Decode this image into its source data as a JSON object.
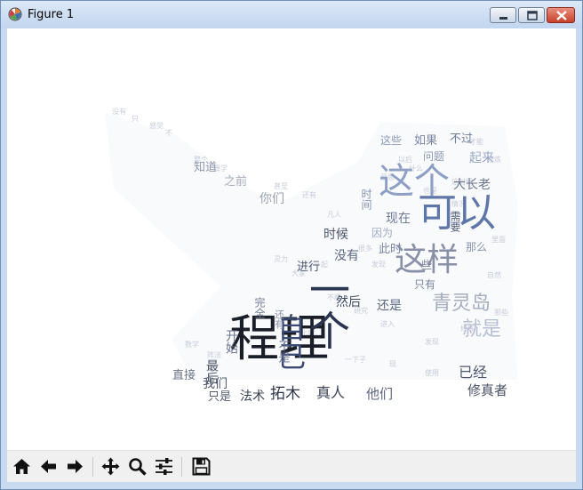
{
  "window": {
    "title": "Figure 1",
    "app_icon": "matplotlib-icon",
    "controls": [
      "minimize-icon",
      "maximize-icon",
      "close-icon"
    ]
  },
  "toolbar": {
    "buttons": [
      {
        "name": "home",
        "icon": "home-icon"
      },
      {
        "name": "back",
        "icon": "arrow-left-icon"
      },
      {
        "name": "forward",
        "icon": "arrow-right-icon"
      },
      {
        "name": "pan",
        "icon": "move-icon"
      },
      {
        "name": "zoom",
        "icon": "magnifier-icon"
      },
      {
        "name": "configure-subplots",
        "icon": "sliders-icon"
      },
      {
        "name": "save",
        "icon": "floppy-disk-icon"
      }
    ]
  },
  "word_cloud": {
    "words": [
      {
        "text": "程理",
        "color": "#1a1e28"
      },
      {
        "text": "自己",
        "color": "#3b4a72"
      },
      {
        "text": "一个",
        "color": "#2a3350"
      },
      {
        "text": "这个",
        "color": "#8e9fc6"
      },
      {
        "text": "可以",
        "color": "#5e76a8"
      },
      {
        "text": "这样",
        "color": "#8a8fa8"
      },
      {
        "text": "青灵岛",
        "color": "#a6acc0"
      },
      {
        "text": "就是",
        "color": "#b7bdd3"
      },
      {
        "text": "已经",
        "color": "#4e5670"
      },
      {
        "text": "修真者",
        "color": "#4a5066"
      },
      {
        "text": "真人",
        "color": "#3e4558"
      },
      {
        "text": "拓木",
        "color": "#2f3549"
      },
      {
        "text": "法术",
        "color": "#3a4155"
      },
      {
        "text": "只是",
        "color": "#555c70"
      },
      {
        "text": "他们",
        "color": "#5a6480"
      },
      {
        "text": "我们",
        "color": "#525a70"
      },
      {
        "text": "直接",
        "color": "#6b7388"
      },
      {
        "text": "最后",
        "color": "#4b526a"
      },
      {
        "text": "开始",
        "color": "#6a7290"
      },
      {
        "text": "然后",
        "color": "#3f4760"
      },
      {
        "text": "还是",
        "color": "#5d6784"
      },
      {
        "text": "进行",
        "color": "#4f5874"
      },
      {
        "text": "时候",
        "color": "#4d556e"
      },
      {
        "text": "没有",
        "color": "#5b6684"
      },
      {
        "text": "现在",
        "color": "#6c7896"
      },
      {
        "text": "因为",
        "color": "#a2abc4"
      },
      {
        "text": "此时",
        "color": "#7c88a8"
      },
      {
        "text": "那么",
        "color": "#8b94ad"
      },
      {
        "text": "只有",
        "color": "#7a839d"
      },
      {
        "text": "你们",
        "color": "#9aa0b4"
      },
      {
        "text": "知道",
        "color": "#9096ac"
      },
      {
        "text": "之前",
        "color": "#a7abbd"
      },
      {
        "text": "如果",
        "color": "#7a86a8"
      },
      {
        "text": "不过",
        "color": "#6f7b9a"
      },
      {
        "text": "这些",
        "color": "#8d98b8"
      },
      {
        "text": "问题",
        "color": "#8d97b2"
      },
      {
        "text": "起来",
        "color": "#9aa6c6"
      },
      {
        "text": "大长老",
        "color": "#6d7690"
      },
      {
        "text": "时间",
        "color": "#8390b2"
      },
      {
        "text": "需要",
        "color": "#515b78"
      },
      {
        "text": "不是",
        "color": "#6a7390"
      },
      {
        "text": "完全",
        "color": "#737c98"
      },
      {
        "text": "些",
        "color": "#7a8298"
      },
      {
        "text": "还有",
        "color": "#8a93ab"
      }
    ]
  }
}
